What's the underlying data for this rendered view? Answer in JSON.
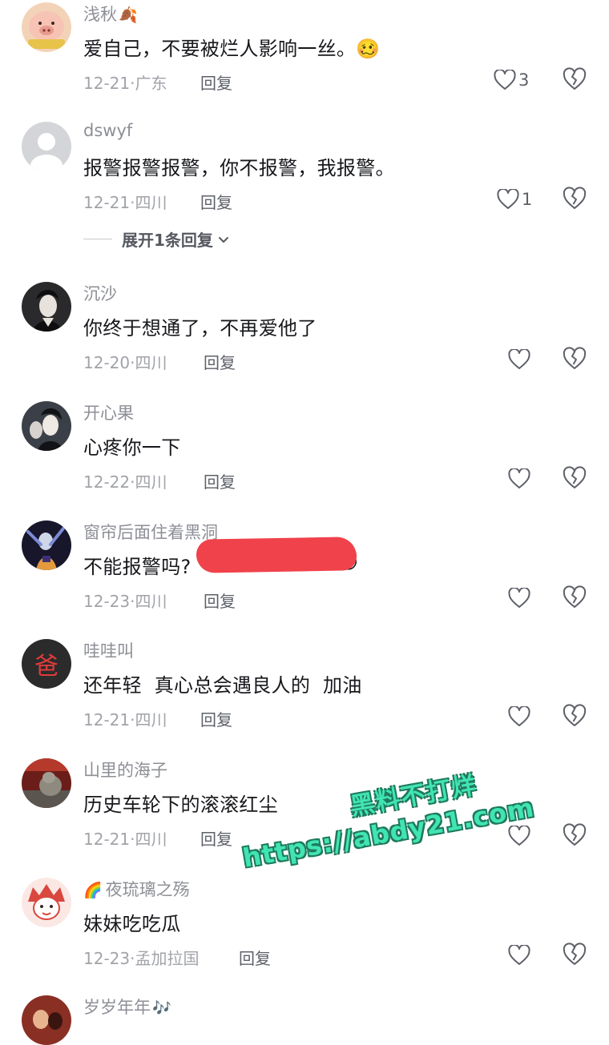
{
  "reply_label": "回复",
  "comments": [
    {
      "author": "浅秋",
      "author_emoji": "🍂",
      "text": "爱自己，不要被烂人影响一丝。",
      "text_emoji": "🥴",
      "date": "12-21",
      "location": "广东",
      "likes": "3"
    },
    {
      "author": "dswyf",
      "text": "报警报警报警，你不报警，我报警。",
      "date": "12-21",
      "location": "四川",
      "likes": "1",
      "expand": "展开1条回复"
    },
    {
      "author": "沉沙",
      "text": "你终于想通了，不再爱他了",
      "date": "12-20",
      "location": "四川",
      "likes": ""
    },
    {
      "author": "开心果",
      "text": "心疼你一下",
      "date": "12-22",
      "location": "四川",
      "likes": ""
    },
    {
      "author": "窗帘后面住着黑洞",
      "text": "不能报警吗?",
      "text_emoji": "😢",
      "date": "12-23",
      "location": "四川",
      "likes": ""
    },
    {
      "author": "哇哇叫",
      "avatar_char": "爸",
      "text": "还年轻  真心总会遇良人的  加油",
      "date": "12-21",
      "location": "四川",
      "likes": ""
    },
    {
      "author": "山里的海子",
      "text": "历史车轮下的滚滚红尘",
      "date": "12-21",
      "location": "四川",
      "likes": ""
    },
    {
      "author": "夜琉璃之殇",
      "author_prefix": "🌈",
      "text": "妹妹吃吃瓜",
      "date": "12-23",
      "location": "孟加拉国",
      "likes": ""
    },
    {
      "author": "岁岁年年",
      "author_emoji": "🎶"
    }
  ],
  "watermark": {
    "line1": "黑料不打烊",
    "line2": "https://abdy21.com"
  },
  "icons": {
    "like": "heart-outline-icon",
    "dislike": "broken-heart-icon"
  },
  "colors": {
    "author": "#8d8f96",
    "text": "#17181c",
    "meta": "#a1a3a9",
    "redaction": "#f0424a",
    "watermark": "#41e4b3"
  }
}
